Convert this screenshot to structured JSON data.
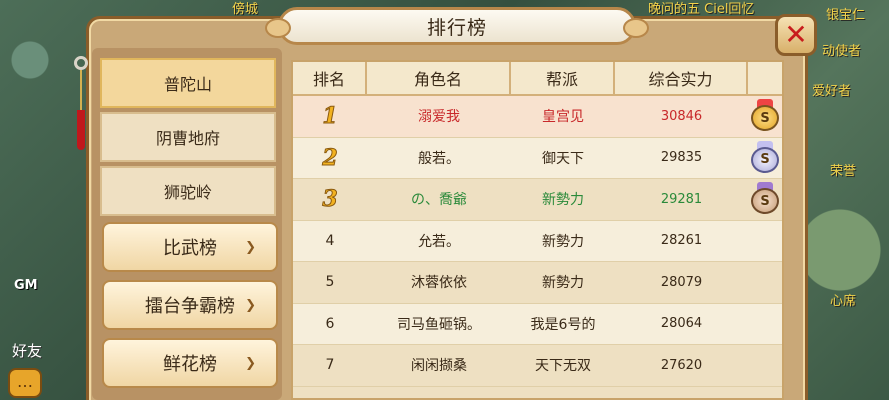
{
  "window": {
    "title": "排行榜",
    "close_label": "✕"
  },
  "scene": {
    "top_left_text": "傍城",
    "top_right_text_1": "晚问的五 Ciel回忆",
    "right_texts": [
      "银宝仁",
      "动使者",
      "爱好者",
      "荣誉",
      "心席"
    ],
    "gm_label": "GM",
    "friend_label": "好友",
    "chat_icon": "chat-bubble-icon"
  },
  "sidebar": {
    "sub_items": [
      {
        "label": "普陀山",
        "active": true
      },
      {
        "label": "阴曹地府",
        "active": false
      },
      {
        "label": "狮驼岭",
        "active": false
      }
    ],
    "categories": [
      {
        "label": "比武榜",
        "icon": "chevron-down-icon"
      },
      {
        "label": "擂台争霸榜",
        "icon": "chevron-down-icon"
      },
      {
        "label": "鲜花榜",
        "icon": "chevron-down-icon"
      }
    ]
  },
  "table": {
    "headers": [
      "排名",
      "角色名",
      "帮派",
      "综合实力"
    ],
    "rows": [
      {
        "rank": "1",
        "name": "溺爱我",
        "guild": "皇宫见",
        "power": "30846",
        "medal": "gold",
        "color": "#c8282a"
      },
      {
        "rank": "2",
        "name": "般若。",
        "guild": "御天下",
        "power": "29835",
        "medal": "silver",
        "color": "#3a2a18"
      },
      {
        "rank": "3",
        "name": "の、喬爺",
        "guild": "新勢力",
        "power": "29281",
        "medal": "bronze",
        "color": "#2a8a3a"
      },
      {
        "rank": "4",
        "name": "允若。",
        "guild": "新勢力",
        "power": "28261"
      },
      {
        "rank": "5",
        "name": "沐蓉依依",
        "guild": "新勢力",
        "power": "28079"
      },
      {
        "rank": "6",
        "name": "司马鱼砸锅。",
        "guild": "我是6号的",
        "power": "28064"
      },
      {
        "rank": "7",
        "name": "闲闲撷桑",
        "guild": "天下无双",
        "power": "27620"
      }
    ]
  },
  "colors": {
    "panel_bg": "#c9a878",
    "table_bg": "#eee0c2",
    "rank1_text": "#c8282a",
    "rank3_text": "#2a8a3a"
  }
}
